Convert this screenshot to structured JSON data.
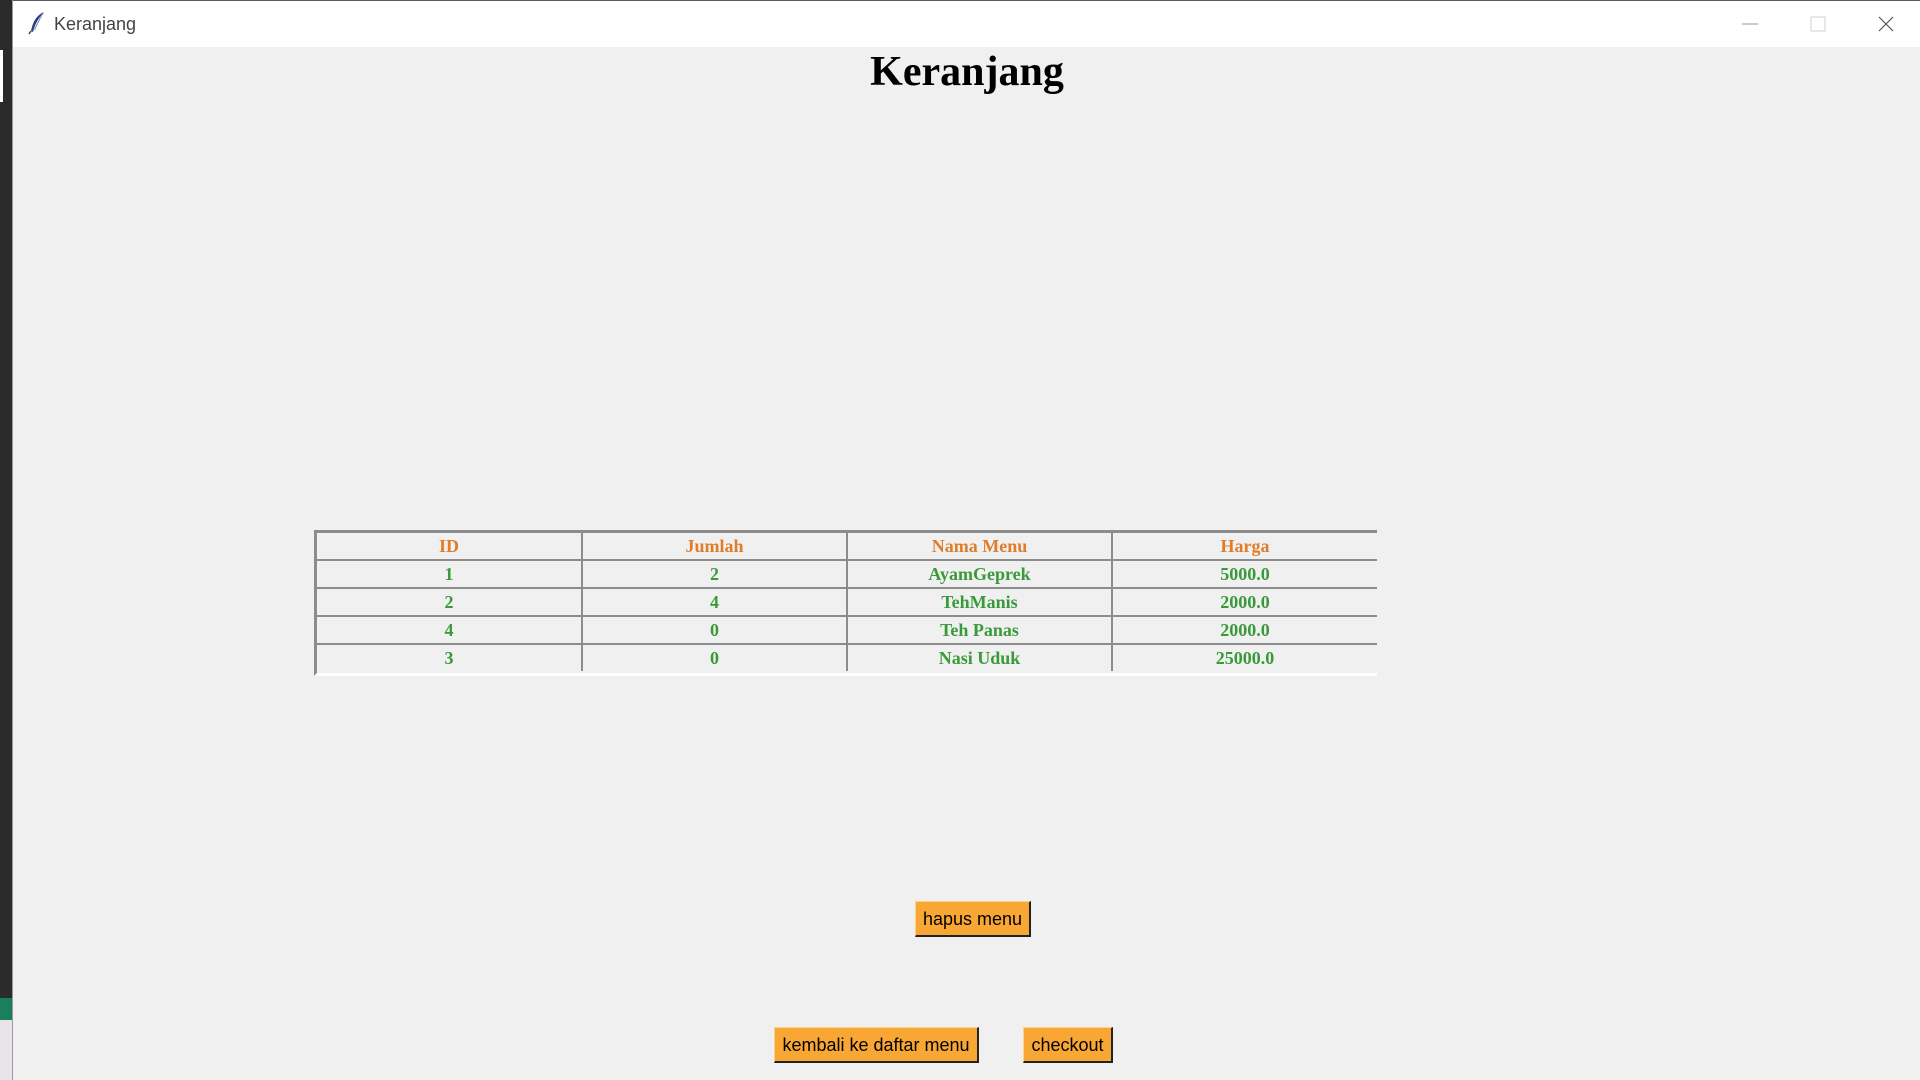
{
  "window": {
    "title": "Keranjang",
    "icon": "feather-icon"
  },
  "page": {
    "heading": "Keranjang"
  },
  "table": {
    "columns": [
      "ID",
      "Jumlah",
      "Nama Menu",
      "Harga"
    ],
    "rows": [
      [
        "1",
        "2",
        "AyamGeprek",
        "5000.0"
      ],
      [
        "2",
        "4",
        "TehManis",
        "2000.0"
      ],
      [
        "4",
        "0",
        "Teh Panas",
        "2000.0"
      ],
      [
        "3",
        "0",
        "Nasi Uduk",
        "25000.0"
      ]
    ]
  },
  "buttons": {
    "hapus": "hapus menu",
    "kembali": "kembali ke daftar menu",
    "checkout": "checkout"
  },
  "colors": {
    "header_text": "#e07d2a",
    "cell_text": "#3a9a3a",
    "button_bg": "#f9a734",
    "window_bg": "#f0f0f0"
  }
}
